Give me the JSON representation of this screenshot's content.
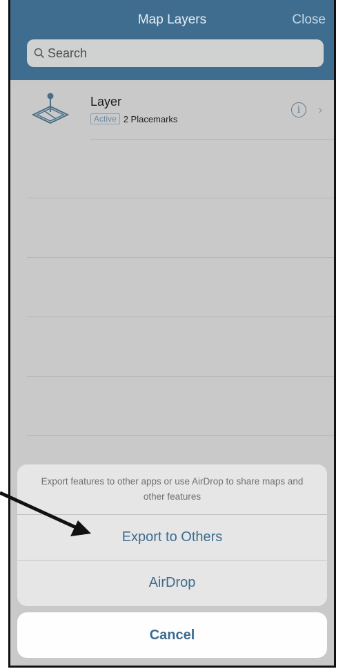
{
  "navbar": {
    "title": "Map Layers",
    "close_label": "Close"
  },
  "search": {
    "placeholder": "Search",
    "icon": "search-icon"
  },
  "layers": [
    {
      "name": "Layer",
      "status": "Active",
      "placemarks": "2 Placemarks",
      "icon": "map-layer-pin-icon"
    }
  ],
  "action_sheet": {
    "message": "Export features to other apps or use AirDrop to share maps and other features",
    "actions": [
      "Export to Others",
      "AirDrop"
    ],
    "cancel_label": "Cancel"
  },
  "colors": {
    "navbar": "#3f6d8f",
    "accent": "#3c6b8f",
    "background": "#c9c9c9"
  }
}
